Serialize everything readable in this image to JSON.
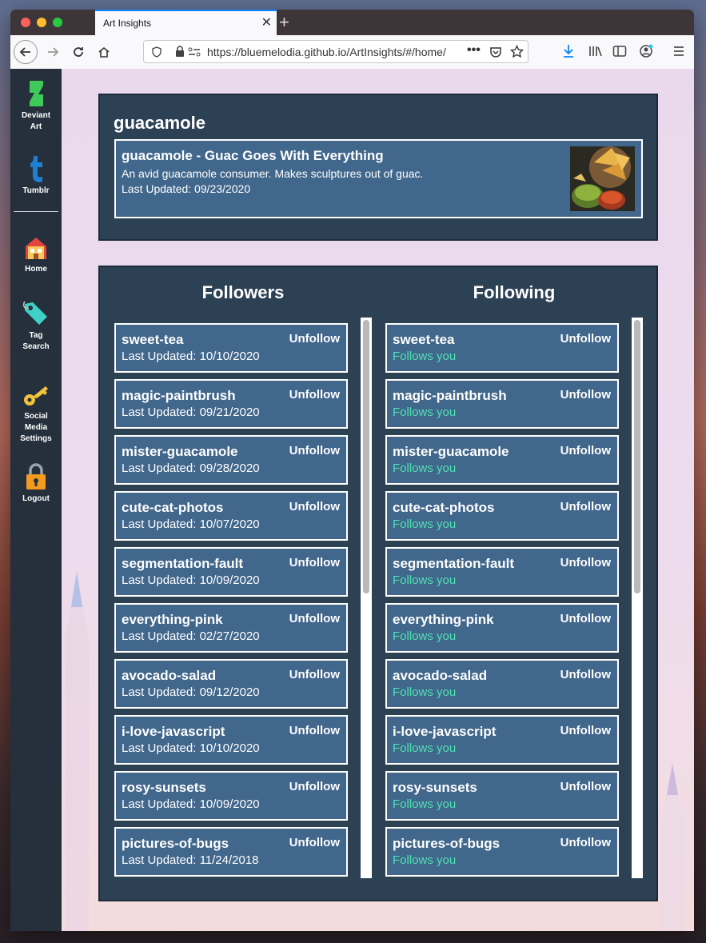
{
  "browser": {
    "tab_title": "Art Insights",
    "url": "https://bluemelodia.github.io/ArtInsights/#/home/"
  },
  "sidebar": {
    "items": [
      {
        "label_line1": "Deviant",
        "label_line2": "Art",
        "icon": "deviantart-icon"
      },
      {
        "label_line1": "Tumblr",
        "label_line2": "",
        "icon": "tumblr-icon"
      },
      {
        "label_line1": "Home",
        "label_line2": "",
        "icon": "home-icon"
      },
      {
        "label_line1": "Tag",
        "label_line2": "Search",
        "icon": "tag-icon"
      },
      {
        "label_line1": "Social",
        "label_line2": "Media",
        "label_line3": "Settings",
        "icon": "key-icon"
      },
      {
        "label_line1": "Logout",
        "label_line2": "",
        "icon": "lock-icon"
      }
    ]
  },
  "profile": {
    "username": "guacamole",
    "card_title": "guacamole - Guac Goes With Everything",
    "description": "An avid guacamole consumer. Makes sculptures out of guac.",
    "last_updated": "Last Updated: 09/23/2020"
  },
  "followers": {
    "title": "Followers",
    "unfollow_label": "Unfollow",
    "items": [
      {
        "name": "sweet-tea",
        "sub": "Last Updated: 10/10/2020"
      },
      {
        "name": "magic-paintbrush",
        "sub": "Last Updated: 09/21/2020"
      },
      {
        "name": "mister-guacamole",
        "sub": "Last Updated: 09/28/2020"
      },
      {
        "name": "cute-cat-photos",
        "sub": "Last Updated: 10/07/2020"
      },
      {
        "name": "segmentation-fault",
        "sub": "Last Updated: 10/09/2020"
      },
      {
        "name": "everything-pink",
        "sub": "Last Updated: 02/27/2020"
      },
      {
        "name": "avocado-salad",
        "sub": "Last Updated: 09/12/2020"
      },
      {
        "name": "i-love-javascript",
        "sub": "Last Updated: 10/10/2020"
      },
      {
        "name": "rosy-sunsets",
        "sub": "Last Updated: 10/09/2020"
      },
      {
        "name": "pictures-of-bugs",
        "sub": "Last Updated: 11/24/2018"
      }
    ]
  },
  "following": {
    "title": "Following",
    "unfollow_label": "Unfollow",
    "items": [
      {
        "name": "sweet-tea",
        "sub": "Follows you"
      },
      {
        "name": "magic-paintbrush",
        "sub": "Follows you"
      },
      {
        "name": "mister-guacamole",
        "sub": "Follows you"
      },
      {
        "name": "cute-cat-photos",
        "sub": "Follows you"
      },
      {
        "name": "segmentation-fault",
        "sub": "Follows you"
      },
      {
        "name": "everything-pink",
        "sub": "Follows you"
      },
      {
        "name": "avocado-salad",
        "sub": "Follows you"
      },
      {
        "name": "i-love-javascript",
        "sub": "Follows you"
      },
      {
        "name": "rosy-sunsets",
        "sub": "Follows you"
      },
      {
        "name": "pictures-of-bugs",
        "sub": "Follows you"
      }
    ]
  },
  "colors": {
    "sidebar_bg": "#25303c",
    "panel_bg": "#2d4155",
    "card_bg": "#41678c",
    "follows_you": "#4fe2b2"
  }
}
